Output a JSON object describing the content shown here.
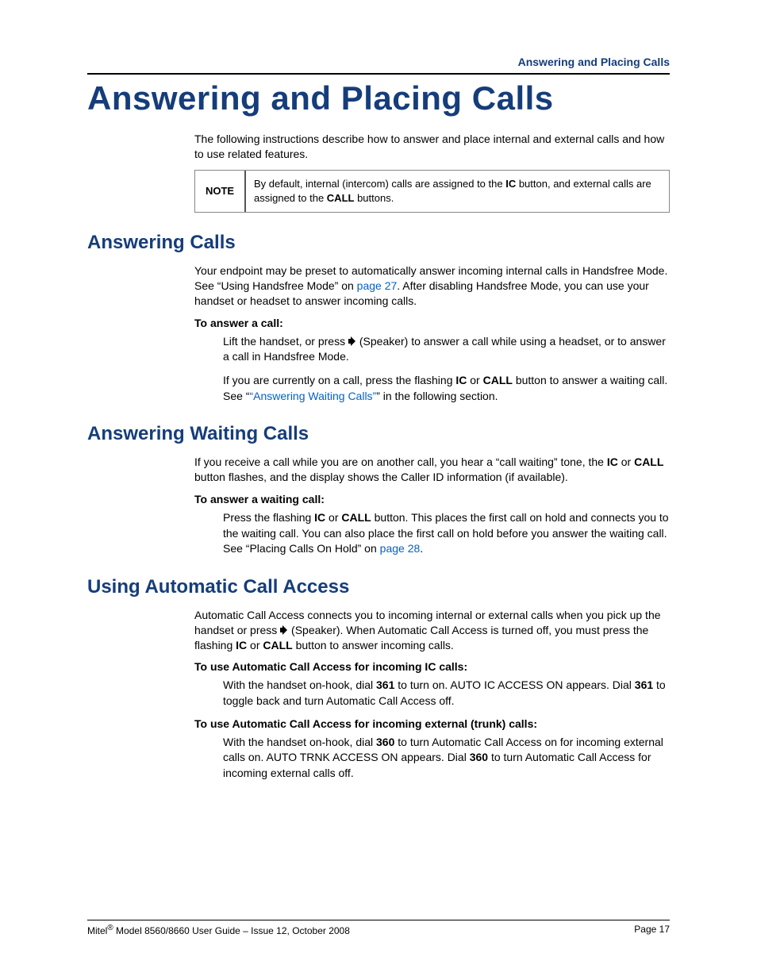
{
  "header": {
    "running": "Answering and Placing Calls"
  },
  "chapter": {
    "title": "Answering and Placing Calls"
  },
  "intro": {
    "lead": "The following instructions describe how to answer and place internal and external calls and how to use related features.",
    "note_label": "NOTE",
    "note_a": "By default, internal (intercom) calls are assigned to the ",
    "note_b": "IC",
    "note_c": " button, and external calls are assigned to the ",
    "note_d": "CALL",
    "note_e": " buttons."
  },
  "s1": {
    "title": "Answering Calls",
    "p1a": "Your endpoint may be preset to automatically answer incoming internal calls in Handsfree Mode. See “Using Handsfree Mode” on ",
    "p1link": "page 27",
    "p1b": ". After disabling Handsfree Mode, you can use your handset or headset to answer incoming calls.",
    "sub": "To answer a call:",
    "step1a": "Lift the handset, or press ",
    "step1b": " (Speaker) to answer a call while using a headset, or to answer a call in Handsfree Mode.",
    "step2a": "If you are currently on a call, press the flashing ",
    "ic": "IC",
    "or": " or ",
    "call": "CALL",
    "step2b": " button to answer a waiting call. See “",
    "step2link": "“Answering Waiting Calls”",
    "step2c": "” in the following section."
  },
  "s2": {
    "title": "Answering Waiting Calls",
    "p1a": "If you receive a call while you are on another call, you hear a “call waiting” tone, the ",
    "ic": "IC",
    "or": " or ",
    "call": "CALL",
    "p1b": " button flashes, and the display shows the Caller ID information (if available).",
    "sub": "To answer a waiting call:",
    "step1a": "Press the flashing ",
    "step1b": " button. This places the first call on hold and connects you to the waiting call. You can also place the first call on hold before you answer the waiting call. See “Placing Calls On Hold” on ",
    "step1link": "page 28",
    "step1c": "."
  },
  "s3": {
    "title": "Using Automatic Call Access",
    "p1a": "Automatic Call Access connects you to incoming internal or external calls when you pick up the handset or press ",
    "p1b": " (Speaker). When Automatic Call Access is turned off, you must press the flashing ",
    "ic": "IC",
    "or": " or ",
    "call": "CALL",
    "p1c": " button to answer incoming calls.",
    "sub1": "To use Automatic Call Access for incoming IC calls:",
    "step1a": "With the handset on-hook, dial ",
    "code361": "361",
    "step1b": " to turn on. AUTO IC ACCESS ON appears. Dial ",
    "step1c": " to toggle back and turn Automatic Call Access off.",
    "sub2": "To use Automatic Call Access for incoming external (trunk) calls:",
    "step2a": "With the handset on-hook, dial ",
    "code360": "360",
    "step2b": " to turn Automatic Call Access on for incoming external calls on. AUTO TRNK ACCESS ON appears. Dial ",
    "step2c": " to turn Automatic Call Access for incoming external calls off."
  },
  "footer": {
    "left_a": "Mitel",
    "left_b": " Model 8560/8660 User Guide – Issue 12, October 2008",
    "right": "Page 17"
  }
}
